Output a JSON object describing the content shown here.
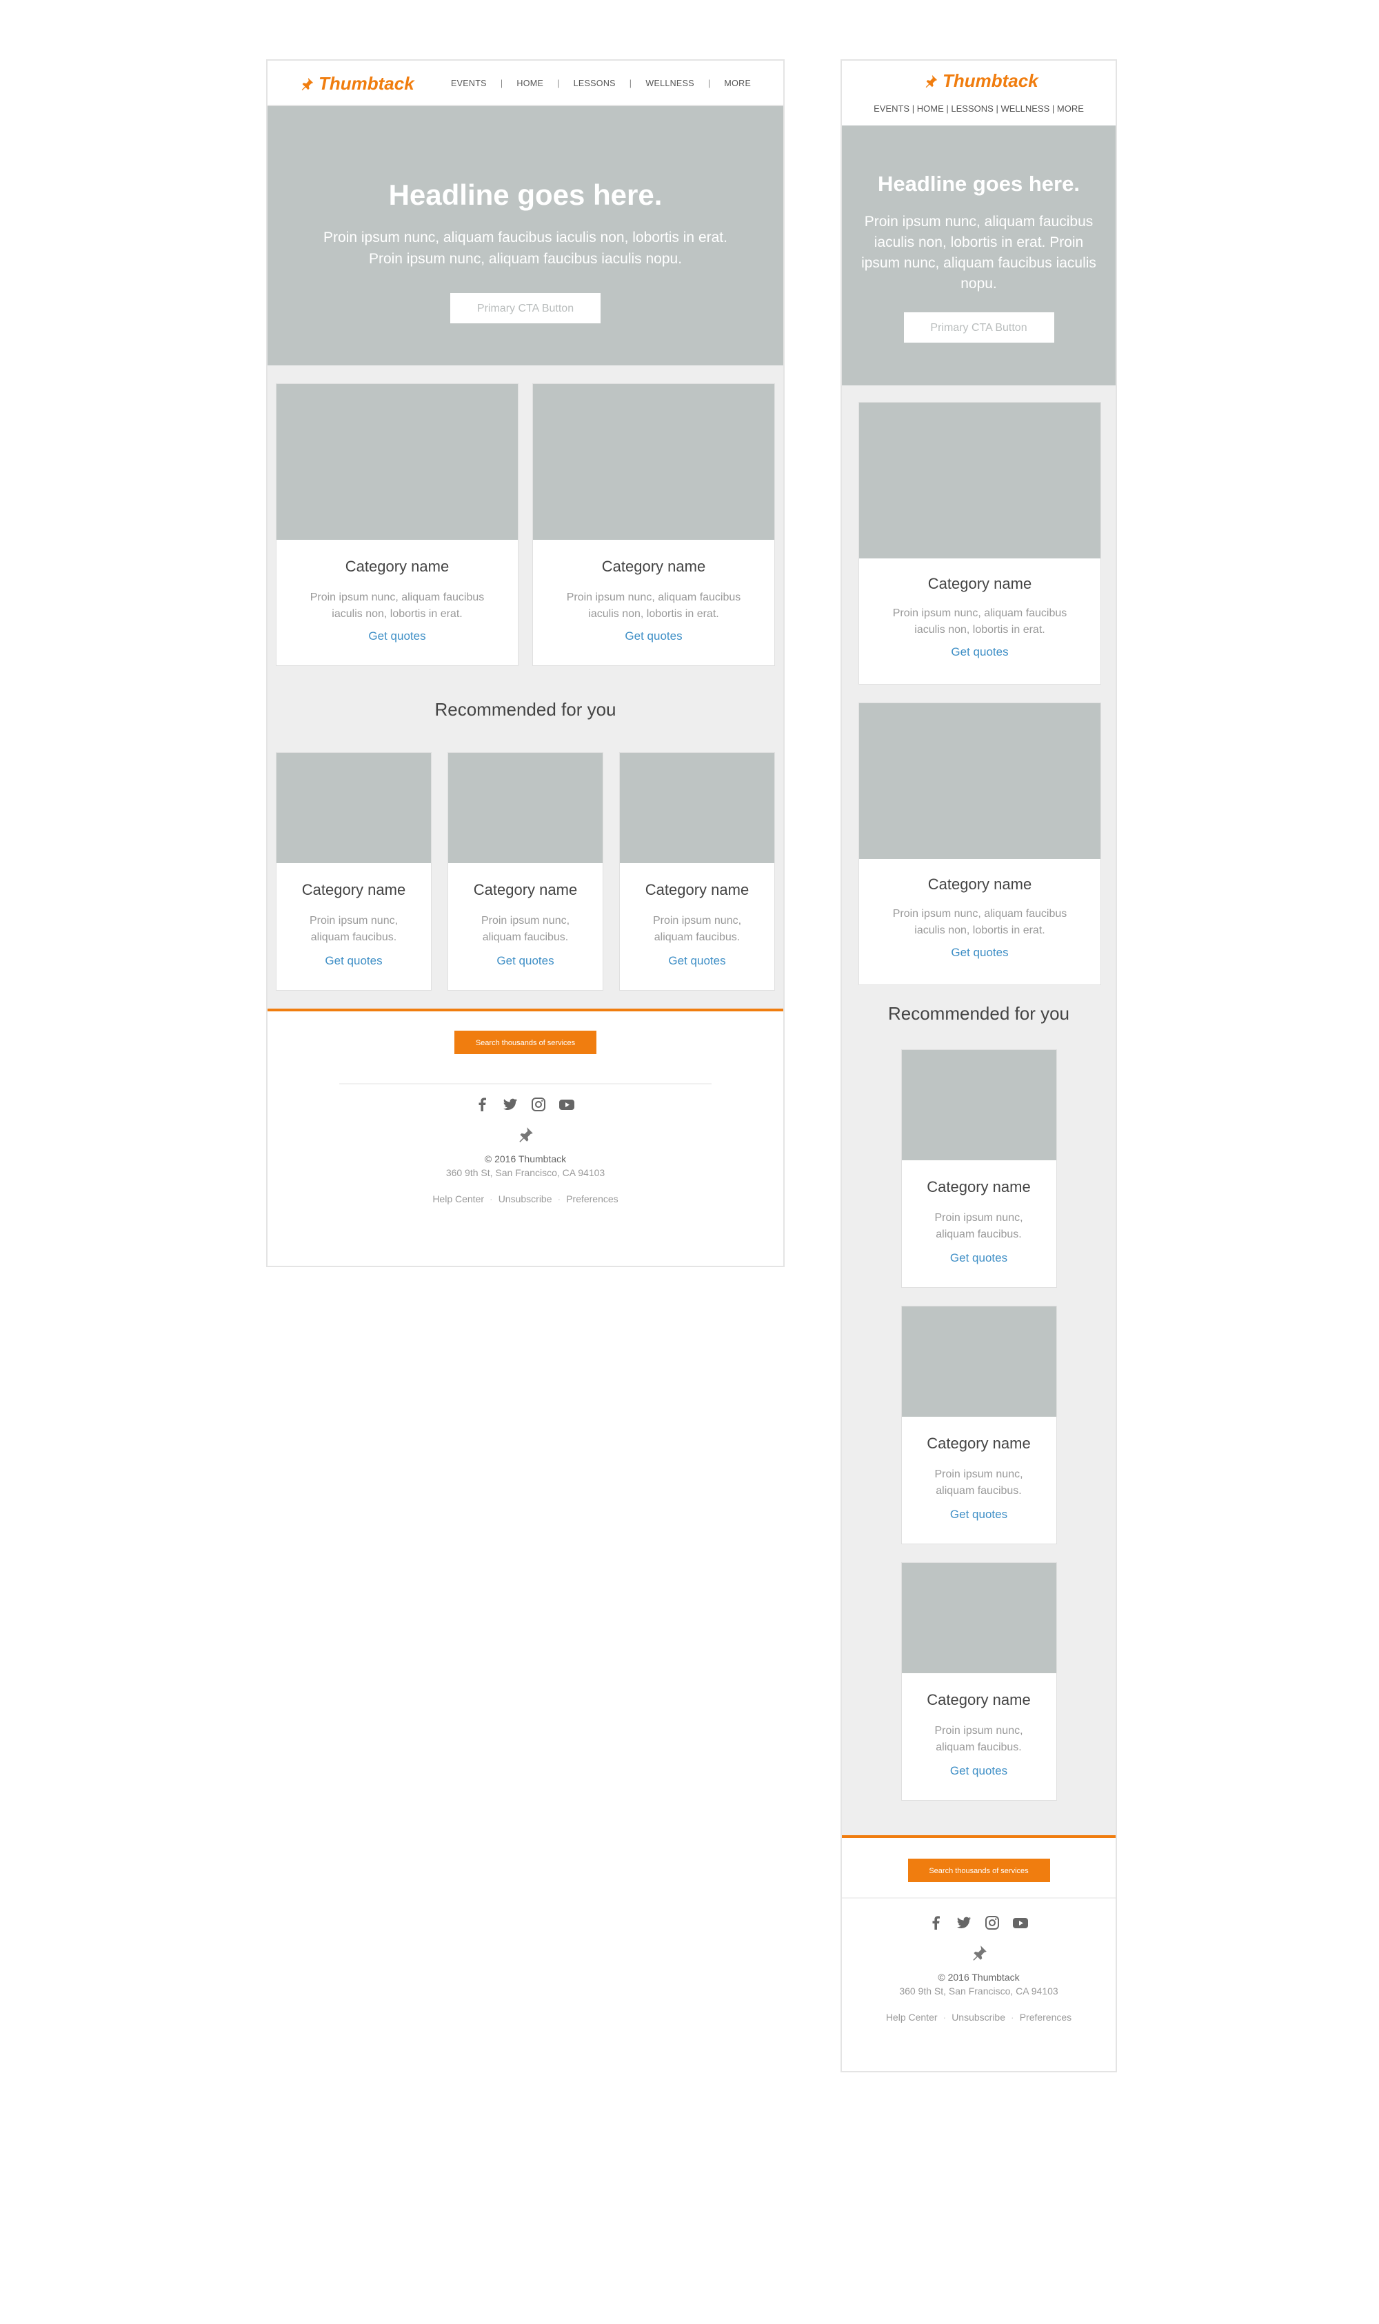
{
  "brand": {
    "name": "Thumbtack",
    "accent": "#f07d0f",
    "link": "#3f8fc6",
    "placeholder": "#bec4c3"
  },
  "nav": [
    "EVENTS",
    "HOME",
    "LESSONS",
    "WELLNESS",
    "MORE"
  ],
  "nav_separator": "|",
  "hero": {
    "headline": "Headline goes here.",
    "body": "Proin ipsum nunc, aliquam faucibus iaculis non, lobortis in erat. Proin ipsum nunc, aliquam faucibus iaculis nopu.",
    "cta": "Primary CTA Button"
  },
  "featured": [
    {
      "title": "Category name",
      "desc": "Proin ipsum nunc, aliquam faucibus iaculis non, lobortis in erat.",
      "link": "Get quotes"
    },
    {
      "title": "Category name",
      "desc": "Proin ipsum nunc, aliquam faucibus iaculis non, lobortis in erat.",
      "link": "Get quotes"
    }
  ],
  "recommended": {
    "title": "Recommended for you",
    "items": [
      {
        "title": "Category name",
        "desc": "Proin ipsum nunc, aliquam faucibus.",
        "link": "Get quotes"
      },
      {
        "title": "Category name",
        "desc": "Proin ipsum nunc, aliquam faucibus.",
        "link": "Get quotes"
      },
      {
        "title": "Category name",
        "desc": "Proin ipsum nunc, aliquam faucibus.",
        "link": "Get quotes"
      }
    ]
  },
  "footer": {
    "search_button": "Search thousands of services",
    "social_icons": [
      "facebook-icon",
      "twitter-icon",
      "instagram-icon",
      "youtube-icon"
    ],
    "copyright": "© 2016 Thumbtack",
    "address": "360 9th St, San Francisco, CA 94103",
    "links": [
      "Help Center",
      "Unsubscribe",
      "Preferences"
    ],
    "link_separator": "·"
  }
}
